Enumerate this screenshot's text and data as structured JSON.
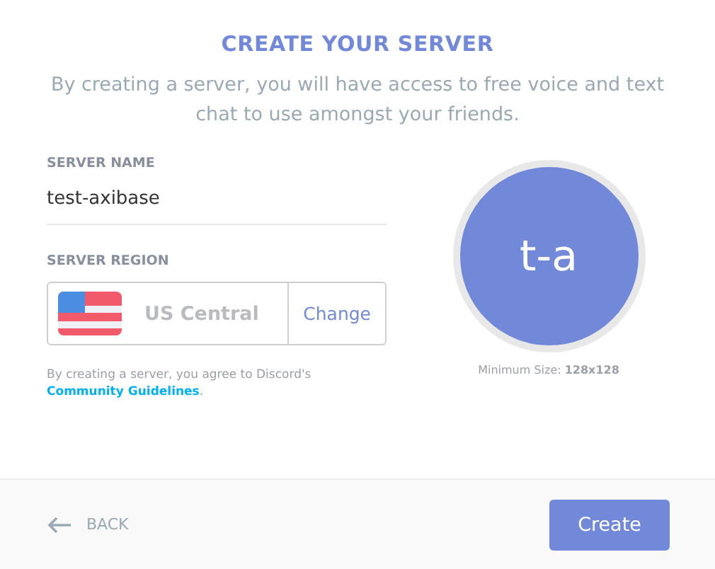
{
  "title": "CREATE YOUR SERVER",
  "subtitle": "By creating a server, you will have access to free voice and text chat to use amongst your friends.",
  "server_name": {
    "label": "SERVER NAME",
    "value": "test-axibase"
  },
  "server_region": {
    "label": "SERVER REGION",
    "value": "US Central",
    "button": "Change"
  },
  "terms": {
    "text": "By creating a server, you agree to Discord's",
    "link": "Community Guidelines",
    "after": "."
  },
  "icon": {
    "initials": "t-a",
    "hint": "Minimum Size: **128x128**"
  },
  "footer": {
    "back": "BACK",
    "create": "Create"
  }
}
